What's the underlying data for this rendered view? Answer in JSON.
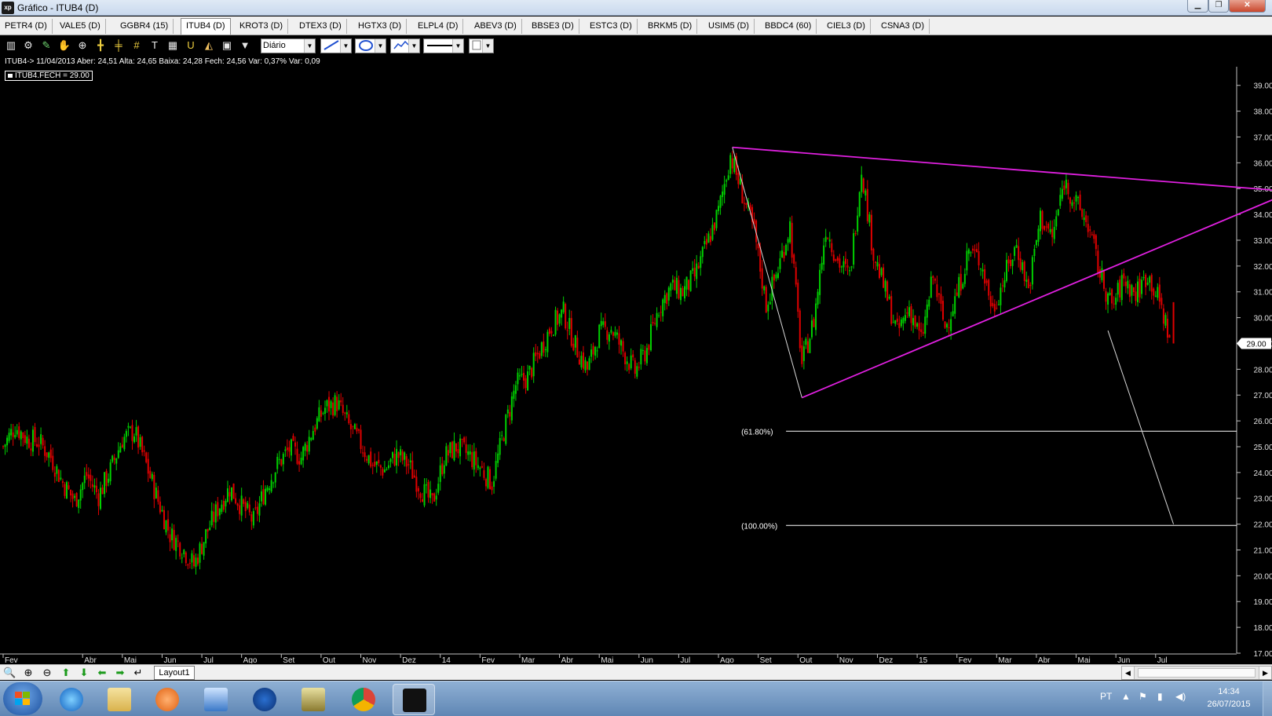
{
  "window": {
    "title": "Gráfico - ITUB4 (D)",
    "app_icon": "xp"
  },
  "tabs": [
    "PETR4 (D)",
    "VALE5 (D)",
    "GGBR4 (15)",
    "ITUB4 (D)",
    "KROT3 (D)",
    "DTEX3 (D)",
    "HGTX3 (D)",
    "ELPL4 (D)",
    "ABEV3 (D)",
    "BBSE3 (D)",
    "ESTC3 (D)",
    "BRKM5 (D)",
    "USIM5 (D)",
    "BBDC4 (60)",
    "CIEL3 (D)",
    "CSNA3 (D)"
  ],
  "active_tab": "ITUB4 (D)",
  "toolbar": {
    "icons": [
      "bar-chart-icon",
      "gear-icon",
      "pencil-icon",
      "hand-icon",
      "zoom-area-icon",
      "crosshair-icon",
      "horizontal-lines-icon",
      "grid-lines-icon",
      "text-icon",
      "table-icon",
      "magnet-icon",
      "bucket-icon",
      "lock-icon",
      "filter-icon"
    ],
    "period": "Diário"
  },
  "info_line": "ITUB4-> 11/04/2013 Aber: 24,51 Alta: 24,65 Baixa: 24,28 Fech: 24,56 Var: 0,37% Var: 0,09",
  "legend": "ITUB4.FECH = 29.00",
  "colors": {
    "up": "#00d000",
    "down": "#e00000",
    "trendline": "#e020e0",
    "fib": "#ffffff",
    "background": "#000000"
  },
  "chart_data": {
    "type": "candlestick",
    "ylim": [
      17,
      39.6
    ],
    "y_ticks": [
      "39.00",
      "38.00",
      "37.00",
      "36.00",
      "35.00",
      "34.00",
      "33.00",
      "32.00",
      "31.00",
      "30.00",
      "29.00",
      "28.00",
      "27.00",
      "26.00",
      "25.00",
      "24.00",
      "23.00",
      "22.00",
      "21.00",
      "20.00",
      "19.00",
      "18.00",
      "17.00"
    ],
    "last_price": "29.00",
    "x_labels": [
      "Fev",
      "Abr",
      "Mai",
      "Jun",
      "Jul",
      "Ago",
      "Set",
      "Out",
      "Nov",
      "Dez",
      "14",
      "Fev",
      "Mar",
      "Abr",
      "Mai",
      "Jun",
      "Jul",
      "Ago",
      "Set",
      "Out",
      "Nov",
      "Dez",
      "15",
      "Fev",
      "Mar",
      "Abr",
      "Mai",
      "Jun",
      "Jul"
    ],
    "x_label_month_index": [
      0,
      2,
      3,
      4,
      5,
      6,
      7,
      8,
      9,
      10,
      11,
      12,
      13,
      14,
      15,
      16,
      17,
      18,
      19,
      20,
      21,
      22,
      23,
      24,
      25,
      26,
      27,
      28,
      29
    ],
    "x_range_months": [
      0,
      31
    ],
    "close_path": [
      [
        0.0,
        25.0
      ],
      [
        0.3,
        25.8
      ],
      [
        0.6,
        25.3
      ],
      [
        0.9,
        25.2
      ],
      [
        1.2,
        24.6
      ],
      [
        1.5,
        23.6
      ],
      [
        1.8,
        22.9
      ],
      [
        2.1,
        23.9
      ],
      [
        2.4,
        23.1
      ],
      [
        2.7,
        24.1
      ],
      [
        3.0,
        25.3
      ],
      [
        3.3,
        25.6
      ],
      [
        3.6,
        24.3
      ],
      [
        3.9,
        22.9
      ],
      [
        4.2,
        21.6
      ],
      [
        4.5,
        21.1
      ],
      [
        4.8,
        20.4
      ],
      [
        5.1,
        21.6
      ],
      [
        5.4,
        22.6
      ],
      [
        5.7,
        23.4
      ],
      [
        6.0,
        22.7
      ],
      [
        6.3,
        22.1
      ],
      [
        6.6,
        23.4
      ],
      [
        6.9,
        24.3
      ],
      [
        7.2,
        24.9
      ],
      [
        7.5,
        24.6
      ],
      [
        7.8,
        25.7
      ],
      [
        8.1,
        26.5
      ],
      [
        8.4,
        26.7
      ],
      [
        8.7,
        25.8
      ],
      [
        9.0,
        25.1
      ],
      [
        9.3,
        24.3
      ],
      [
        9.6,
        24.1
      ],
      [
        9.9,
        24.7
      ],
      [
        10.2,
        24.3
      ],
      [
        10.5,
        23.4
      ],
      [
        10.8,
        22.8
      ],
      [
        11.1,
        24.6
      ],
      [
        11.4,
        25.0
      ],
      [
        11.7,
        24.7
      ],
      [
        12.0,
        24.2
      ],
      [
        12.3,
        23.6
      ],
      [
        12.6,
        25.6
      ],
      [
        12.9,
        27.4
      ],
      [
        13.2,
        27.7
      ],
      [
        13.5,
        28.7
      ],
      [
        13.8,
        29.7
      ],
      [
        14.1,
        30.2
      ],
      [
        14.4,
        28.9
      ],
      [
        14.7,
        28.0
      ],
      [
        15.0,
        29.4
      ],
      [
        15.3,
        29.6
      ],
      [
        15.6,
        28.7
      ],
      [
        15.9,
        27.9
      ],
      [
        16.2,
        28.8
      ],
      [
        16.5,
        30.4
      ],
      [
        16.8,
        31.2
      ],
      [
        17.1,
        31.0
      ],
      [
        17.4,
        31.6
      ],
      [
        17.7,
        32.8
      ],
      [
        18.0,
        34.1
      ],
      [
        18.3,
        36.3
      ],
      [
        18.6,
        34.8
      ],
      [
        18.9,
        33.3
      ],
      [
        19.2,
        30.5
      ],
      [
        19.5,
        31.9
      ],
      [
        19.8,
        33.6
      ],
      [
        20.1,
        28.2
      ],
      [
        20.4,
        29.9
      ],
      [
        20.7,
        33.5
      ],
      [
        21.0,
        32.2
      ],
      [
        21.3,
        31.6
      ],
      [
        21.6,
        35.8
      ],
      [
        21.9,
        32.5
      ],
      [
        22.2,
        31.0
      ],
      [
        22.5,
        29.4
      ],
      [
        22.8,
        30.4
      ],
      [
        23.1,
        29.1
      ],
      [
        23.4,
        31.6
      ],
      [
        23.7,
        29.6
      ],
      [
        24.0,
        30.9
      ],
      [
        24.3,
        32.6
      ],
      [
        24.6,
        32.2
      ],
      [
        24.9,
        30.3
      ],
      [
        25.2,
        31.6
      ],
      [
        25.5,
        32.8
      ],
      [
        25.8,
        31.1
      ],
      [
        26.1,
        33.9
      ],
      [
        26.4,
        33.1
      ],
      [
        26.7,
        35.3
      ],
      [
        27.0,
        34.4
      ],
      [
        27.3,
        33.6
      ],
      [
        27.6,
        31.7
      ],
      [
        27.9,
        30.4
      ],
      [
        28.2,
        31.5
      ],
      [
        28.5,
        30.9
      ],
      [
        28.8,
        31.7
      ],
      [
        29.1,
        30.6
      ],
      [
        29.4,
        29.0
      ]
    ],
    "trendlines": [
      {
        "from": [
          18.35,
          36.6
        ],
        "to": [
          32.3,
          34.9
        ]
      },
      {
        "from": [
          20.1,
          26.9
        ],
        "to": [
          32.3,
          34.8
        ]
      },
      {
        "from": [
          18.35,
          36.6
        ],
        "to": [
          20.1,
          26.9
        ]
      },
      {
        "from": [
          27.8,
          29.5
        ],
        "to": [
          29.45,
          22.0
        ]
      }
    ],
    "fib_levels": [
      {
        "label": "(61.80%)",
        "value": 25.6,
        "x_start": 19.7
      },
      {
        "label": "(100.00%)",
        "value": 21.95,
        "x_start": 19.7
      }
    ]
  },
  "navbar": {
    "icons": [
      "zoom-icon",
      "zoom-in-icon",
      "zoom-out-icon",
      "arrow-up-icon",
      "arrow-down-icon",
      "arrow-left-icon",
      "arrow-right-icon",
      "return-icon"
    ],
    "layout_tab": "Layout1"
  },
  "taskbar": {
    "apps": [
      "internet-explorer-icon",
      "file-explorer-icon",
      "media-player-icon",
      "remote-desktop-icon",
      "hp-icon",
      "scanner-icon",
      "chrome-icon",
      "xp-icon"
    ],
    "lang": "PT",
    "time": "14:34",
    "date": "26/07/2015"
  }
}
